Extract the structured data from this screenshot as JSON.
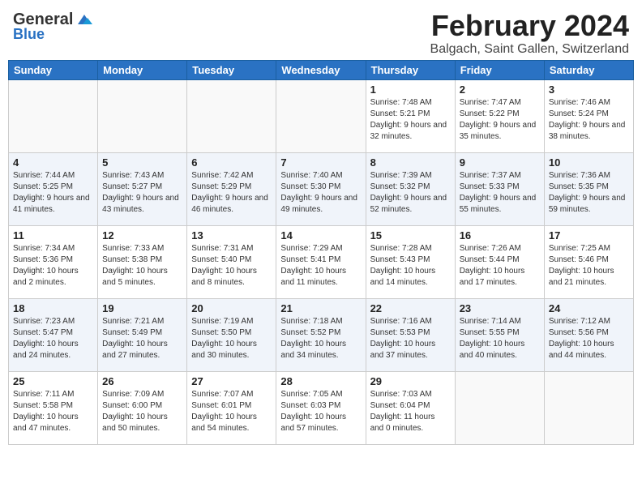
{
  "header": {
    "logo_general": "General",
    "logo_blue": "Blue",
    "title": "February 2024",
    "subtitle": "Balgach, Saint Gallen, Switzerland"
  },
  "weekdays": [
    "Sunday",
    "Monday",
    "Tuesday",
    "Wednesday",
    "Thursday",
    "Friday",
    "Saturday"
  ],
  "weeks": [
    [
      {
        "date": "",
        "info": ""
      },
      {
        "date": "",
        "info": ""
      },
      {
        "date": "",
        "info": ""
      },
      {
        "date": "",
        "info": ""
      },
      {
        "date": "1",
        "info": "Sunrise: 7:48 AM\nSunset: 5:21 PM\nDaylight: 9 hours\nand 32 minutes."
      },
      {
        "date": "2",
        "info": "Sunrise: 7:47 AM\nSunset: 5:22 PM\nDaylight: 9 hours\nand 35 minutes."
      },
      {
        "date": "3",
        "info": "Sunrise: 7:46 AM\nSunset: 5:24 PM\nDaylight: 9 hours\nand 38 minutes."
      }
    ],
    [
      {
        "date": "4",
        "info": "Sunrise: 7:44 AM\nSunset: 5:25 PM\nDaylight: 9 hours\nand 41 minutes."
      },
      {
        "date": "5",
        "info": "Sunrise: 7:43 AM\nSunset: 5:27 PM\nDaylight: 9 hours\nand 43 minutes."
      },
      {
        "date": "6",
        "info": "Sunrise: 7:42 AM\nSunset: 5:29 PM\nDaylight: 9 hours\nand 46 minutes."
      },
      {
        "date": "7",
        "info": "Sunrise: 7:40 AM\nSunset: 5:30 PM\nDaylight: 9 hours\nand 49 minutes."
      },
      {
        "date": "8",
        "info": "Sunrise: 7:39 AM\nSunset: 5:32 PM\nDaylight: 9 hours\nand 52 minutes."
      },
      {
        "date": "9",
        "info": "Sunrise: 7:37 AM\nSunset: 5:33 PM\nDaylight: 9 hours\nand 55 minutes."
      },
      {
        "date": "10",
        "info": "Sunrise: 7:36 AM\nSunset: 5:35 PM\nDaylight: 9 hours\nand 59 minutes."
      }
    ],
    [
      {
        "date": "11",
        "info": "Sunrise: 7:34 AM\nSunset: 5:36 PM\nDaylight: 10 hours\nand 2 minutes."
      },
      {
        "date": "12",
        "info": "Sunrise: 7:33 AM\nSunset: 5:38 PM\nDaylight: 10 hours\nand 5 minutes."
      },
      {
        "date": "13",
        "info": "Sunrise: 7:31 AM\nSunset: 5:40 PM\nDaylight: 10 hours\nand 8 minutes."
      },
      {
        "date": "14",
        "info": "Sunrise: 7:29 AM\nSunset: 5:41 PM\nDaylight: 10 hours\nand 11 minutes."
      },
      {
        "date": "15",
        "info": "Sunrise: 7:28 AM\nSunset: 5:43 PM\nDaylight: 10 hours\nand 14 minutes."
      },
      {
        "date": "16",
        "info": "Sunrise: 7:26 AM\nSunset: 5:44 PM\nDaylight: 10 hours\nand 17 minutes."
      },
      {
        "date": "17",
        "info": "Sunrise: 7:25 AM\nSunset: 5:46 PM\nDaylight: 10 hours\nand 21 minutes."
      }
    ],
    [
      {
        "date": "18",
        "info": "Sunrise: 7:23 AM\nSunset: 5:47 PM\nDaylight: 10 hours\nand 24 minutes."
      },
      {
        "date": "19",
        "info": "Sunrise: 7:21 AM\nSunset: 5:49 PM\nDaylight: 10 hours\nand 27 minutes."
      },
      {
        "date": "20",
        "info": "Sunrise: 7:19 AM\nSunset: 5:50 PM\nDaylight: 10 hours\nand 30 minutes."
      },
      {
        "date": "21",
        "info": "Sunrise: 7:18 AM\nSunset: 5:52 PM\nDaylight: 10 hours\nand 34 minutes."
      },
      {
        "date": "22",
        "info": "Sunrise: 7:16 AM\nSunset: 5:53 PM\nDaylight: 10 hours\nand 37 minutes."
      },
      {
        "date": "23",
        "info": "Sunrise: 7:14 AM\nSunset: 5:55 PM\nDaylight: 10 hours\nand 40 minutes."
      },
      {
        "date": "24",
        "info": "Sunrise: 7:12 AM\nSunset: 5:56 PM\nDaylight: 10 hours\nand 44 minutes."
      }
    ],
    [
      {
        "date": "25",
        "info": "Sunrise: 7:11 AM\nSunset: 5:58 PM\nDaylight: 10 hours\nand 47 minutes."
      },
      {
        "date": "26",
        "info": "Sunrise: 7:09 AM\nSunset: 6:00 PM\nDaylight: 10 hours\nand 50 minutes."
      },
      {
        "date": "27",
        "info": "Sunrise: 7:07 AM\nSunset: 6:01 PM\nDaylight: 10 hours\nand 54 minutes."
      },
      {
        "date": "28",
        "info": "Sunrise: 7:05 AM\nSunset: 6:03 PM\nDaylight: 10 hours\nand 57 minutes."
      },
      {
        "date": "29",
        "info": "Sunrise: 7:03 AM\nSunset: 6:04 PM\nDaylight: 11 hours\nand 0 minutes."
      },
      {
        "date": "",
        "info": ""
      },
      {
        "date": "",
        "info": ""
      }
    ]
  ]
}
